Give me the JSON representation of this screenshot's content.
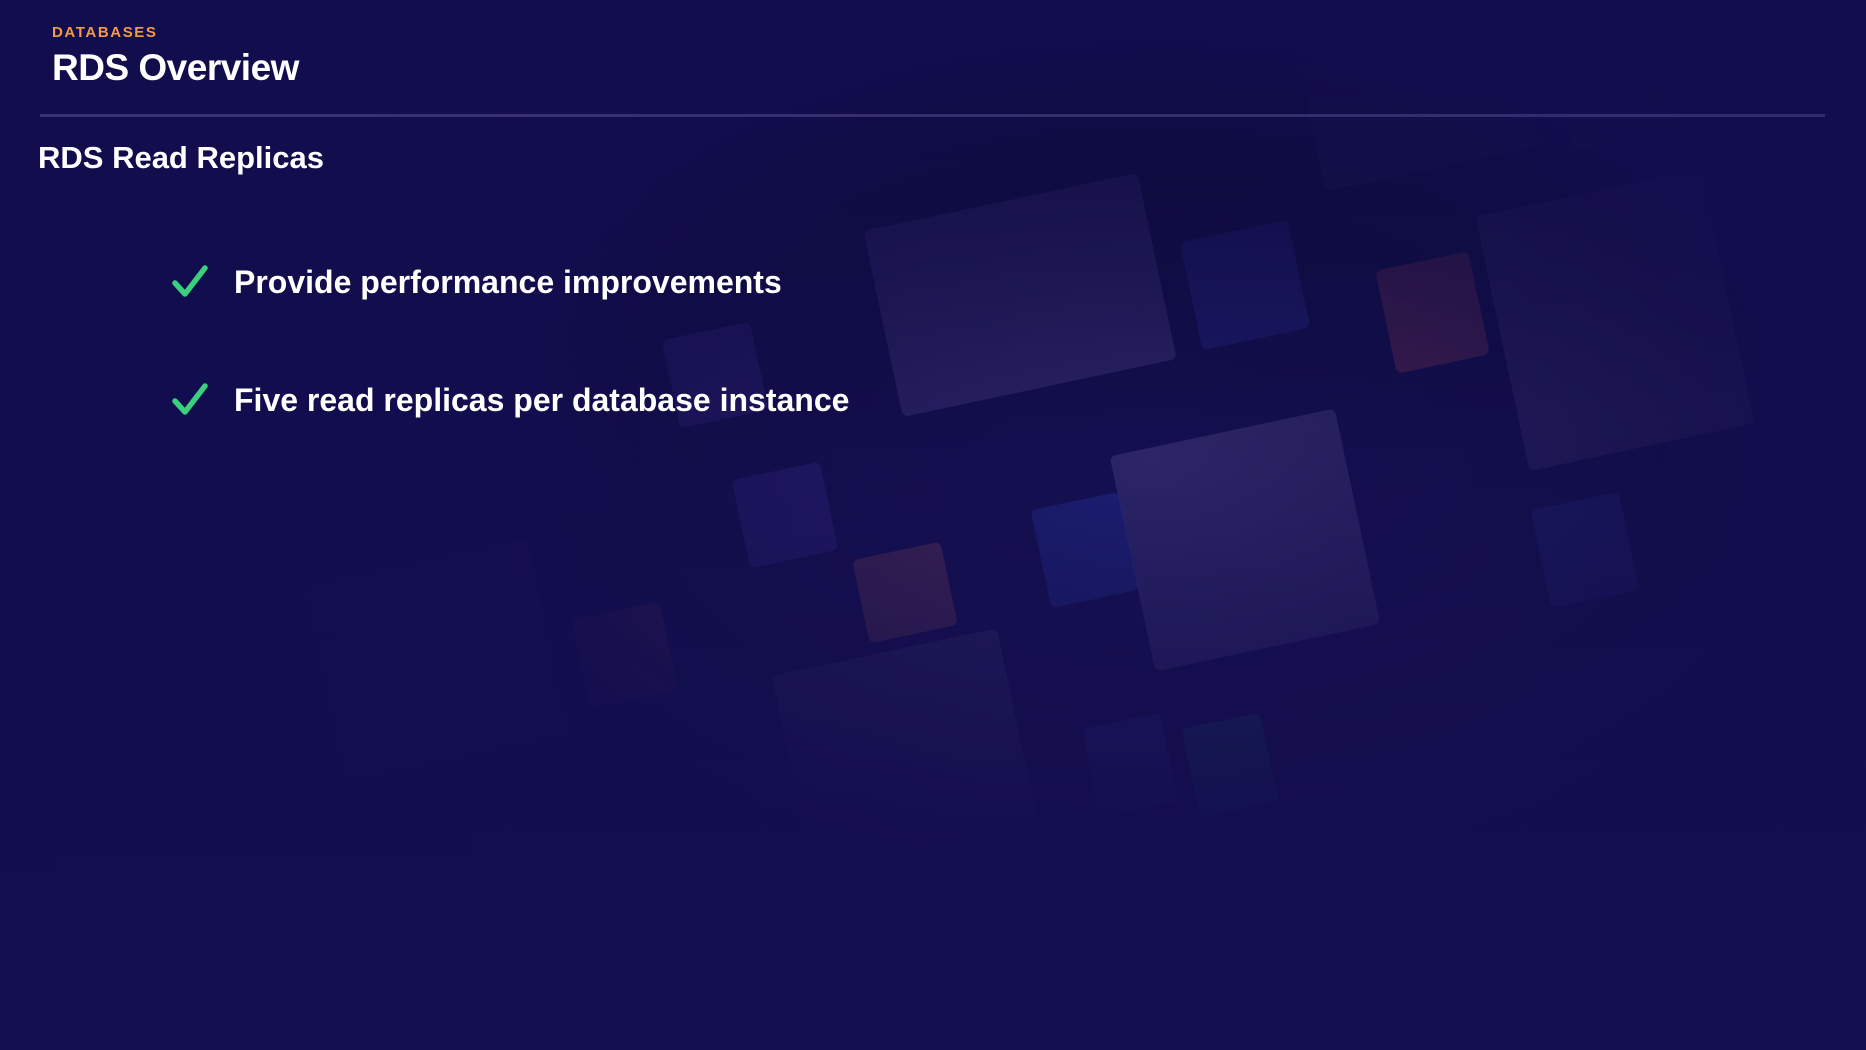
{
  "slide": {
    "section_label": "DATABASES",
    "title": "RDS Overview",
    "subtitle": "RDS Read Replicas",
    "bullets": [
      {
        "icon": "check-icon",
        "text": "Provide performance improvements"
      },
      {
        "icon": "check-icon",
        "text": "Five read replicas per database instance"
      }
    ]
  },
  "colors": {
    "background": "#140f4f",
    "accent_label": "#f39a45",
    "check": "#3ad07d",
    "text": "#ffffff"
  }
}
